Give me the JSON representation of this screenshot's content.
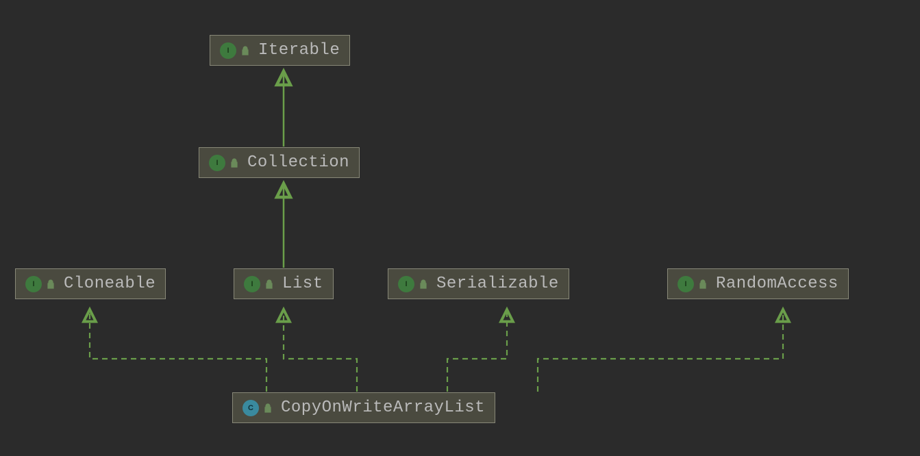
{
  "diagram": {
    "nodes": {
      "iterable": {
        "label": "Iterable",
        "type": "interface"
      },
      "collection": {
        "label": "Collection",
        "type": "interface"
      },
      "cloneable": {
        "label": "Cloneable",
        "type": "interface"
      },
      "list": {
        "label": "List",
        "type": "interface"
      },
      "serializable": {
        "label": "Serializable",
        "type": "interface"
      },
      "randomaccess": {
        "label": "RandomAccess",
        "type": "interface"
      },
      "copyonwritearraylist": {
        "label": "CopyOnWriteArrayList",
        "type": "class"
      }
    },
    "icons": {
      "interface_letter": "I",
      "class_letter": "C"
    },
    "edges": [
      {
        "from": "collection",
        "to": "iterable",
        "style": "solid"
      },
      {
        "from": "list",
        "to": "collection",
        "style": "solid"
      },
      {
        "from": "copyonwritearraylist",
        "to": "cloneable",
        "style": "dashed"
      },
      {
        "from": "copyonwritearraylist",
        "to": "list",
        "style": "dashed"
      },
      {
        "from": "copyonwritearraylist",
        "to": "serializable",
        "style": "dashed"
      },
      {
        "from": "copyonwritearraylist",
        "to": "randomaccess",
        "style": "dashed"
      }
    ],
    "colors": {
      "background": "#2b2b2b",
      "node_bg": "#4a4a3f",
      "node_border": "#888878",
      "text": "#bababa",
      "arrow": "#6a9e4a",
      "interface_icon": "#3e7a3e",
      "class_icon": "#3a8a9e"
    }
  }
}
